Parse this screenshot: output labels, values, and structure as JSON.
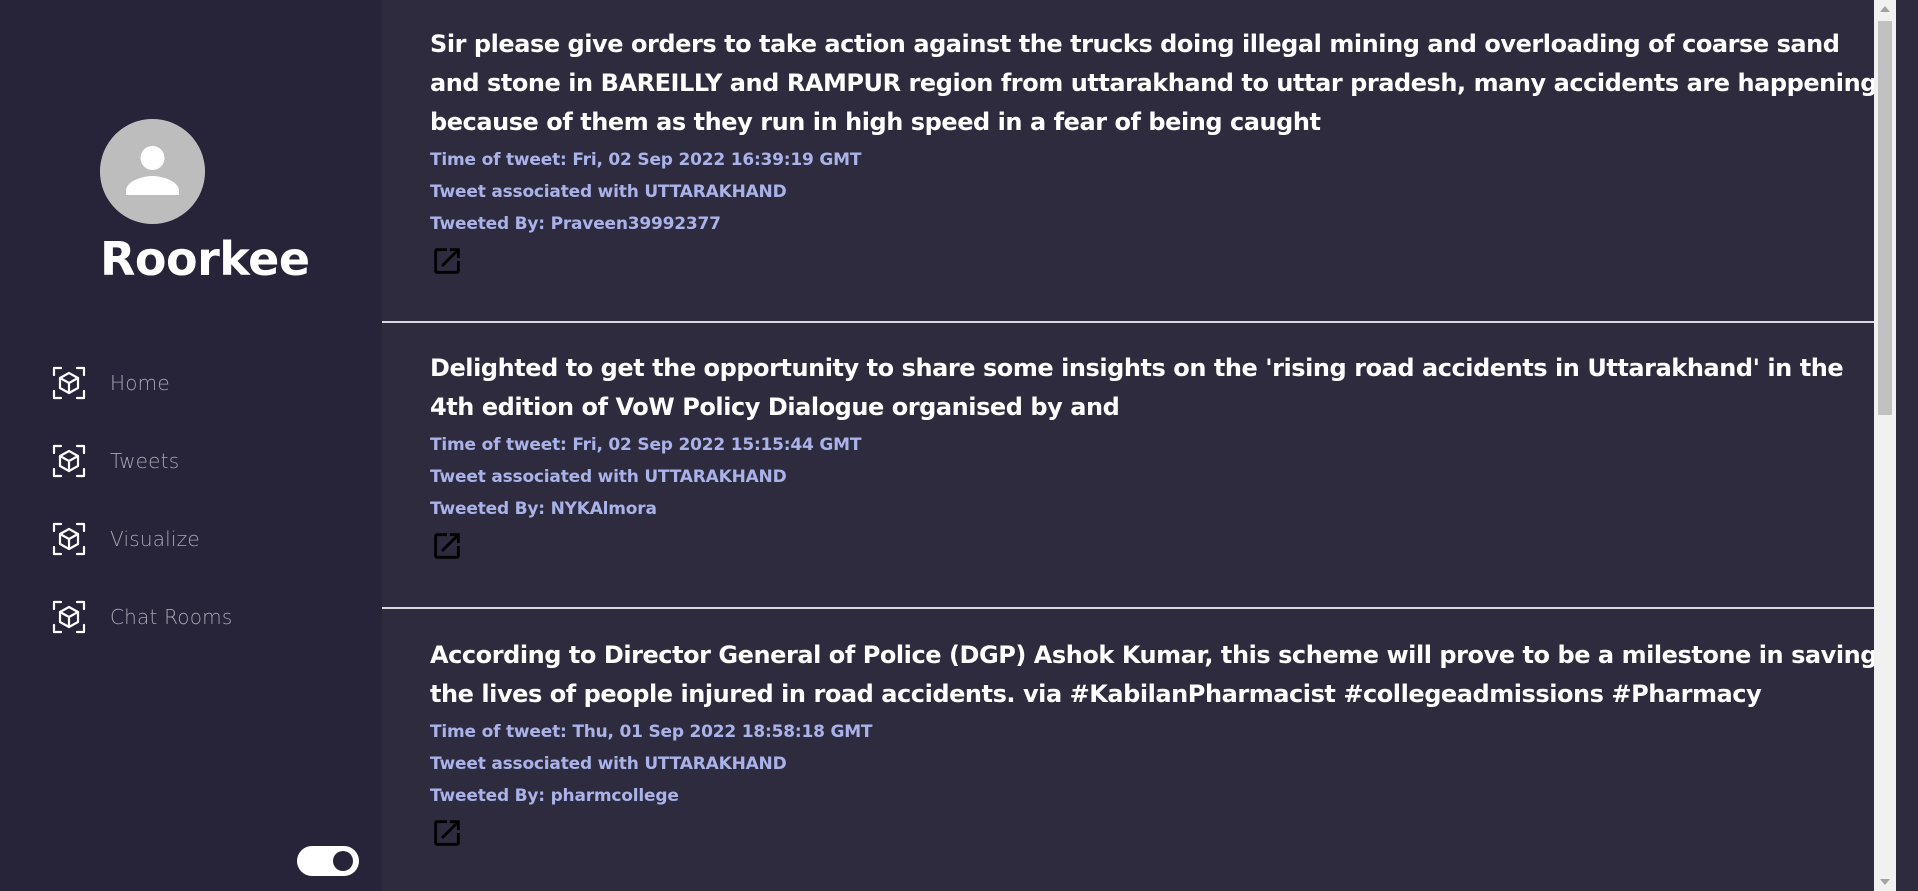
{
  "sidebar": {
    "city_name": "Roorkee",
    "avatar_icon": "person-icon",
    "nav_items": [
      {
        "label": "Home",
        "icon": "cube-scan-icon"
      },
      {
        "label": "Tweets",
        "icon": "cube-scan-icon"
      },
      {
        "label": "Visualize",
        "icon": "cube-scan-icon"
      },
      {
        "label": "Chat Rooms",
        "icon": "cube-scan-icon"
      }
    ],
    "theme_toggle_on": true
  },
  "tweets": [
    {
      "text": "Sir please give orders to take action against the trucks doing illegal mining and overloading of coarse sand and stone in BAREILLY and RAMPUR region from uttarakhand to uttar pradesh, many accidents are happening because of them as they run in high speed in a fear of being caught",
      "time": "Time of tweet: Fri, 02 Sep 2022 16:39:19 GMT",
      "associated": "Tweet associated with UTTARAKHAND",
      "tweeted_by": "Tweeted By: Praveen39992377"
    },
    {
      "text": "Delighted to get the opportunity to share some insights on the 'rising road accidents in Uttarakhand' in the 4th edition of VoW Policy Dialogue organised by and",
      "time": "Time of tweet: Fri, 02 Sep 2022 15:15:44 GMT",
      "associated": "Tweet associated with UTTARAKHAND",
      "tweeted_by": "Tweeted By: NYKAlmora"
    },
    {
      "text": "According to Director General of Police (DGP) Ashok Kumar, this scheme will prove to be a milestone in saving the lives of people injured in road accidents. via #KabilanPharmacist #collegeadmissions #Pharmacy",
      "time": "Time of tweet: Thu, 01 Sep 2022 18:58:18 GMT",
      "associated": "Tweet associated with UTTARAKHAND",
      "tweeted_by": "Tweeted By: pharmcollege"
    }
  ],
  "colors": {
    "sidebar_bg": "#27243a",
    "main_bg": "#2f2b3e",
    "meta_text": "#a9b3ea",
    "nav_text": "#a7a5b3"
  }
}
